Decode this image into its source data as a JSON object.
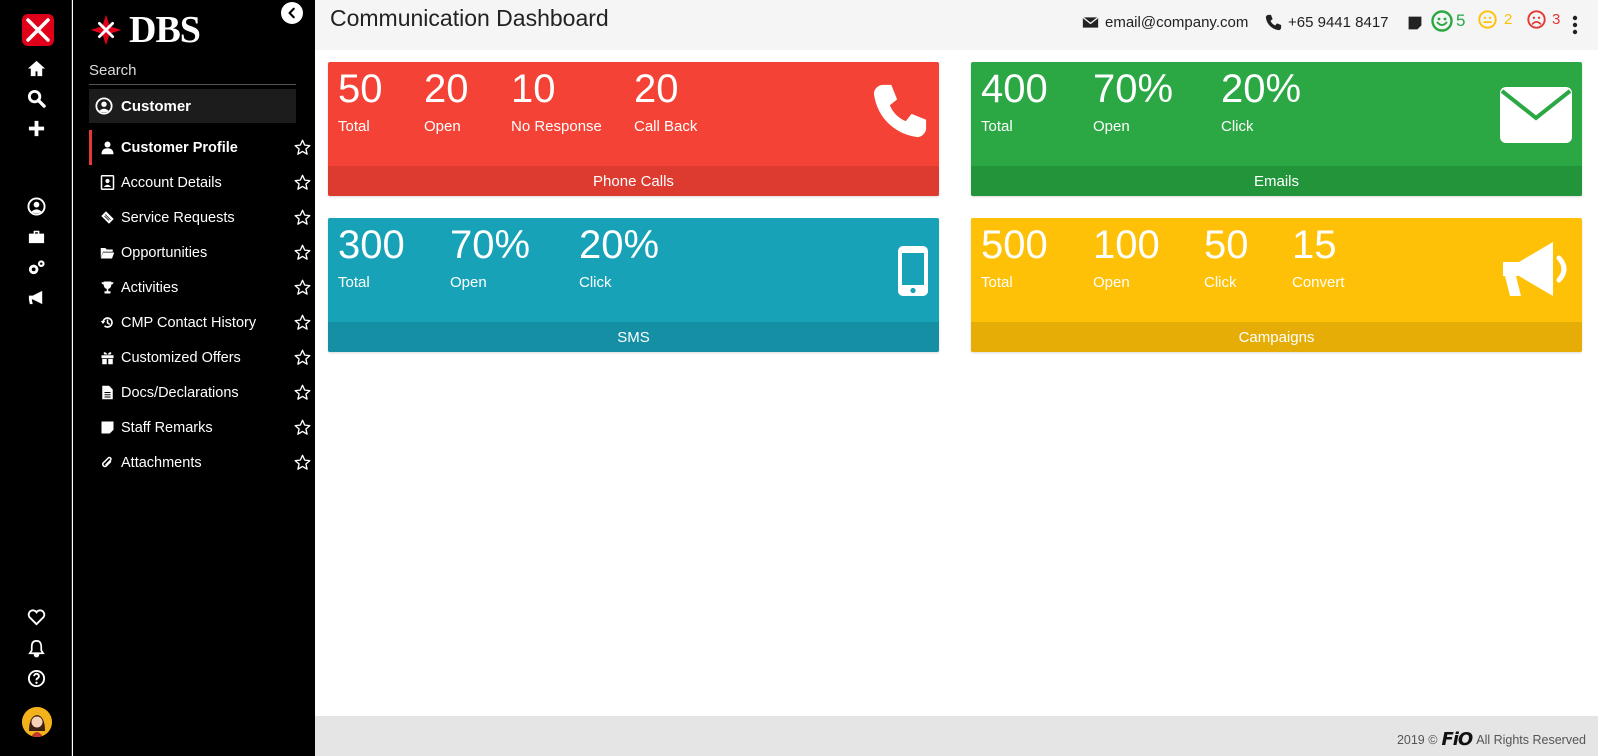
{
  "brand": {
    "name": "DBS"
  },
  "sidebar": {
    "search_label": "Search",
    "customer_label": "Customer",
    "items": [
      {
        "label": "Customer Profile",
        "icon": "user-icon",
        "active": true
      },
      {
        "label": "Account Details",
        "icon": "id-card-icon"
      },
      {
        "label": "Service Requests",
        "icon": "ticket-icon"
      },
      {
        "label": "Opportunities",
        "icon": "folder-open-icon"
      },
      {
        "label": "Activities",
        "icon": "trophy-icon"
      },
      {
        "label": "CMP Contact History",
        "icon": "history-icon"
      },
      {
        "label": "Customized Offers",
        "icon": "gift-icon"
      },
      {
        "label": "Docs/Declarations",
        "icon": "document-icon"
      },
      {
        "label": "Staff Remarks",
        "icon": "sticky-note-icon"
      },
      {
        "label": "Attachments",
        "icon": "paperclip-icon"
      }
    ]
  },
  "header": {
    "title": "Communication Dashboard",
    "email": "email@company.com",
    "phone": "+65 9441 8417",
    "sentiment": {
      "happy": "5",
      "neutral": "2",
      "sad": "3"
    }
  },
  "cards": {
    "phone": {
      "title": "Phone Calls",
      "stats": [
        {
          "value": "50",
          "label": "Total"
        },
        {
          "value": "20",
          "label": "Open"
        },
        {
          "value": "10",
          "label": "No Response"
        },
        {
          "value": "20",
          "label": "Call Back"
        }
      ]
    },
    "email": {
      "title": "Emails",
      "stats": [
        {
          "value": "400",
          "label": "Total"
        },
        {
          "value": "70%",
          "label": "Open"
        },
        {
          "value": "20%",
          "label": "Click"
        }
      ]
    },
    "sms": {
      "title": "SMS",
      "stats": [
        {
          "value": "300",
          "label": "Total"
        },
        {
          "value": "70%",
          "label": "Open"
        },
        {
          "value": "20%",
          "label": "Click"
        }
      ]
    },
    "campaigns": {
      "title": "Campaigns",
      "stats": [
        {
          "value": "500",
          "label": "Total"
        },
        {
          "value": "100",
          "label": "Open"
        },
        {
          "value": "50",
          "label": "Click"
        },
        {
          "value": "15",
          "label": "Convert"
        }
      ]
    }
  },
  "footer": {
    "year": "2019 ©",
    "brand": "FiO",
    "rights": "All Rights Reserved"
  },
  "colors": {
    "phone": "#f44336",
    "email": "#2ba844",
    "sms": "#17a2b8",
    "campaigns": "#ffc107",
    "accent": "#e53935"
  }
}
